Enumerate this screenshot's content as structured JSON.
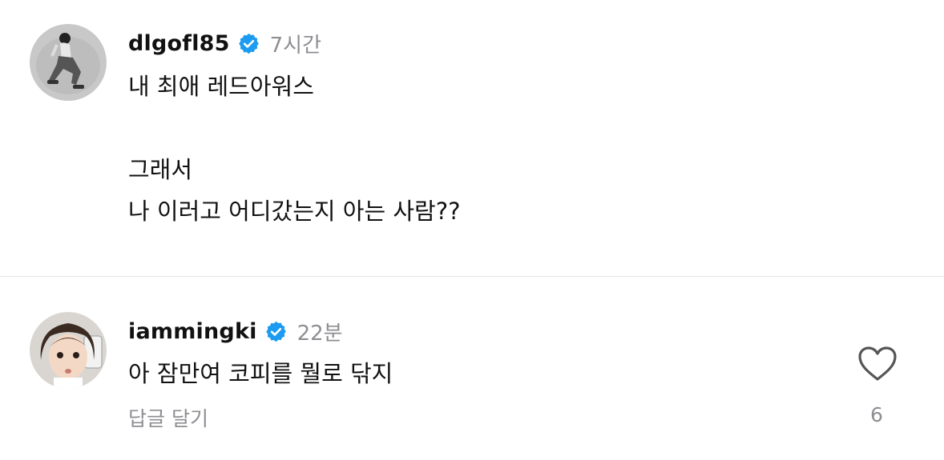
{
  "comments": [
    {
      "username": "dlgofl85",
      "time": "7시간",
      "lines": [
        "내 최애 레드아워스",
        "",
        "그래서",
        "나 이러고 어디갔는지 아는 사람??"
      ]
    },
    {
      "username": "iammingki",
      "time": "22분",
      "lines": [
        "아 잠만여 코피를 뭘로 닦지"
      ],
      "reply_label": "답글 달기",
      "like_count": "6"
    }
  ],
  "colors": {
    "verified": "#1d9bf0",
    "muted": "#8e8e93",
    "divider": "#e6e6e6"
  },
  "icons": {
    "verified": "verified-badge-icon",
    "like": "heart-icon"
  }
}
